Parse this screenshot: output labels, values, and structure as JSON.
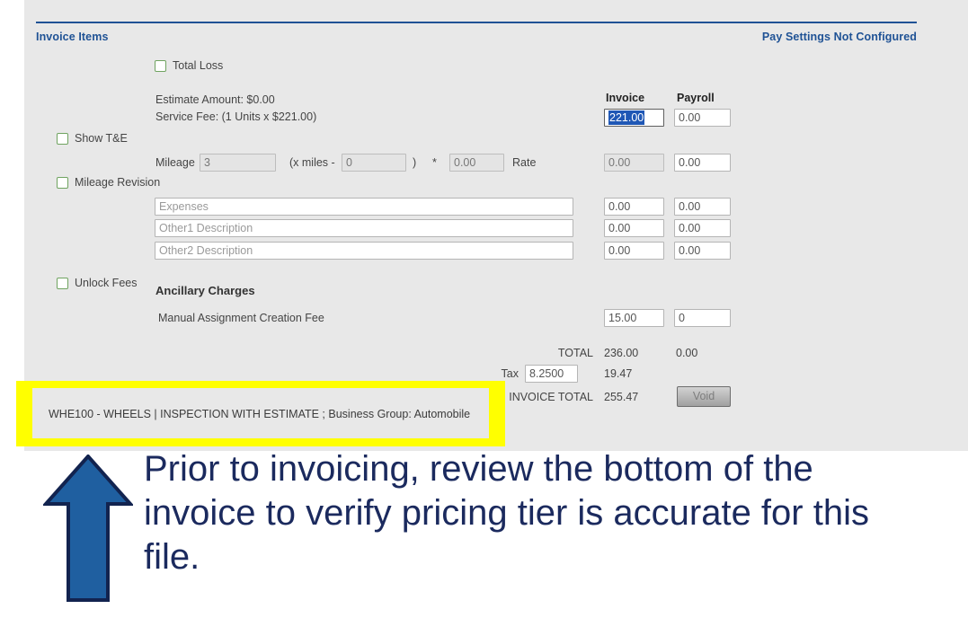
{
  "theme": {
    "panel_bg": "#e8e8e8",
    "accent_blue": "#1f5295",
    "highlight_yellow": "#ffff00",
    "annotation_navy": "#1b2a5e",
    "checkbox_green": "#6fa360",
    "selection_blue": "#1f57b5"
  },
  "section": {
    "title": "Invoice Items",
    "pay_status": "Pay Settings Not Configured"
  },
  "checkboxes": {
    "total_loss": "Total Loss",
    "show_tande": "Show T&E",
    "mileage_revision": "Mileage Revision",
    "unlock_fees": "Unlock Fees"
  },
  "columns": {
    "invoice": "Invoice",
    "payroll": "Payroll"
  },
  "estimate": {
    "amount_label": "Estimate Amount: $0.00",
    "service_fee_label": "Service Fee: (1 Units x $221.00)",
    "service_fee_invoice": "221.00",
    "service_fee_payroll": "0.00"
  },
  "mileage": {
    "label": "Mileage",
    "units": "3",
    "x_miles_label": "(x miles -",
    "miles_value": "0",
    "close_paren": ")",
    "multiply": "*",
    "rate_value": "0.00",
    "rate_label": "Rate",
    "invoice": "0.00",
    "payroll": "0.00"
  },
  "expense_rows": [
    {
      "placeholder": "Expenses",
      "value": "",
      "invoice": "0.00",
      "payroll": "0.00"
    },
    {
      "placeholder": "Other1 Description",
      "value": "",
      "invoice": "0.00",
      "payroll": "0.00"
    },
    {
      "placeholder": "Other2 Description",
      "value": "",
      "invoice": "0.00",
      "payroll": "0.00"
    }
  ],
  "ancillary": {
    "heading": "Ancillary Charges",
    "rows": [
      {
        "label": "Manual Assignment Creation Fee",
        "invoice": "15.00",
        "payroll": "0"
      }
    ]
  },
  "totals": {
    "total_label": "TOTAL",
    "total_invoice": "236.00",
    "total_payroll": "0.00",
    "tax_label": "Tax",
    "tax_rate": "8.2500",
    "tax_amount": "19.47",
    "invoice_total_label": "INVOICE TOTAL",
    "invoice_total_amount": "255.47",
    "void_button": "Void"
  },
  "pricing_tier": {
    "text": "WHE100 - WHEELS | INSPECTION WITH ESTIMATE ; Business Group: Automobile"
  },
  "annotation": {
    "text": "Prior to invoicing, review the bottom of the invoice to verify pricing tier is accurate for this file.",
    "arrow": "up-arrow"
  }
}
